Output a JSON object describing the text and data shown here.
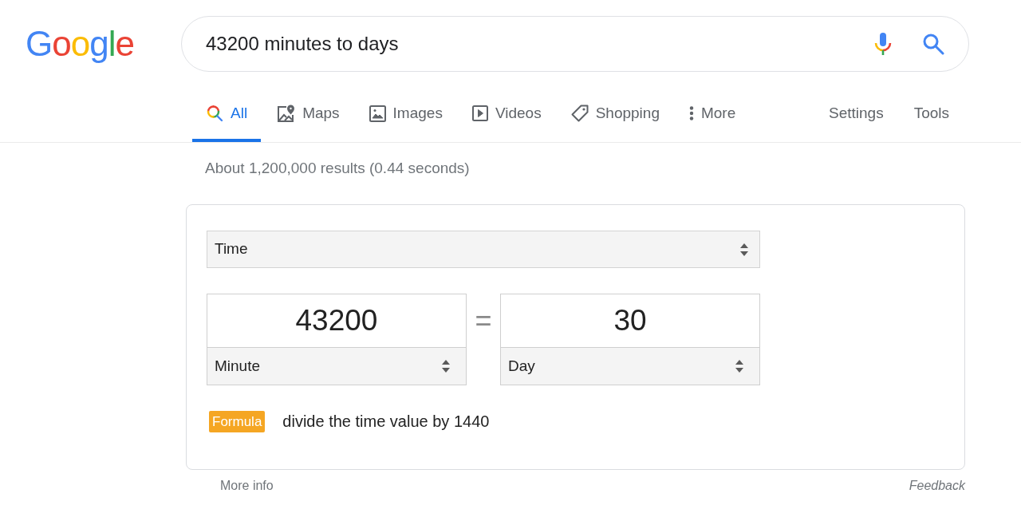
{
  "logo": {
    "text": "Google"
  },
  "search": {
    "value": "43200 minutes to days"
  },
  "tabs": [
    {
      "label": "All",
      "selected": true
    },
    {
      "label": "Maps",
      "selected": false
    },
    {
      "label": "Images",
      "selected": false
    },
    {
      "label": "Videos",
      "selected": false
    },
    {
      "label": "Shopping",
      "selected": false
    },
    {
      "label": "More",
      "selected": false
    }
  ],
  "tools": [
    "Settings",
    "Tools"
  ],
  "result_stats": "About 1,200,000 results (0.44 seconds)",
  "converter": {
    "category": "Time",
    "from": {
      "value": "43200",
      "unit": "Minute"
    },
    "equals": "=",
    "to": {
      "value": "30",
      "unit": "Day"
    },
    "formula": {
      "badge": "Formula",
      "text": "divide the time value by 1440"
    }
  },
  "footer": {
    "more_info": "More info",
    "feedback": "Feedback"
  }
}
